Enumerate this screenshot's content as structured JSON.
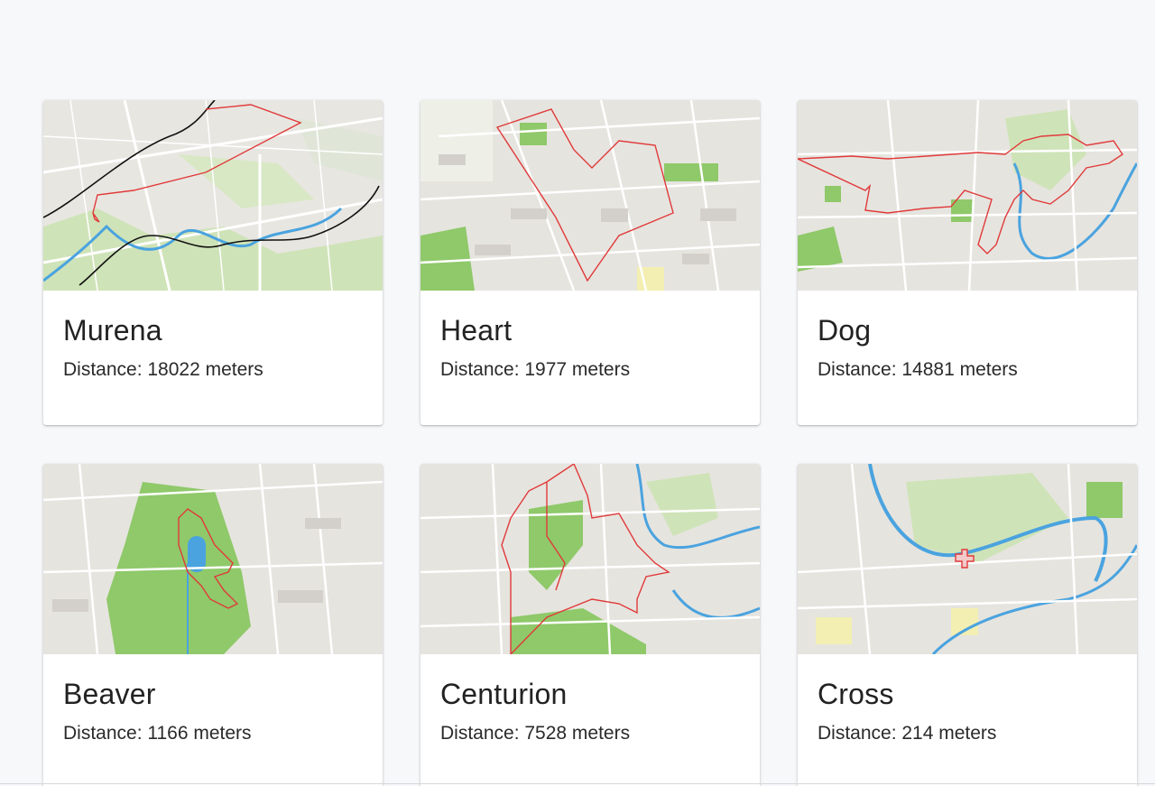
{
  "routes": [
    {
      "name": "Murena",
      "distance_label": "Distance: 18022 meters",
      "map_icon": "route-map-murena"
    },
    {
      "name": "Heart",
      "distance_label": "Distance: 1977 meters",
      "map_icon": "route-map-heart"
    },
    {
      "name": "Dog",
      "distance_label": "Distance: 14881 meters",
      "map_icon": "route-map-dog"
    },
    {
      "name": "Beaver",
      "distance_label": "Distance: 1166 meters",
      "map_icon": "route-map-beaver"
    },
    {
      "name": "Centurion",
      "distance_label": "Distance: 7528 meters",
      "map_icon": "route-map-centurion"
    },
    {
      "name": "Cross",
      "distance_label": "Distance: 214 meters",
      "map_icon": "route-map-cross"
    }
  ],
  "colors": {
    "page_background": "#f7f8fa",
    "route_line": "#e03a3a",
    "river": "#4aa3df",
    "park": "#8fc96a"
  }
}
